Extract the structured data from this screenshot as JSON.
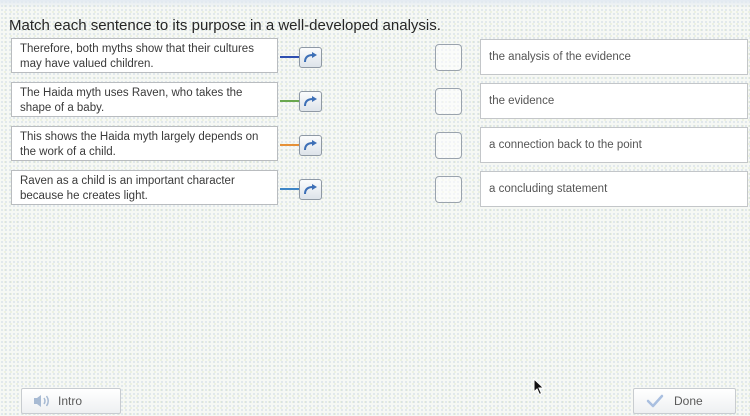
{
  "prompt": "Match each sentence to its purpose in a well-developed analysis.",
  "sentences": [
    {
      "text": "Therefore, both myths show that their cultures may have valued children.",
      "connector_color": "#2e4fb0"
    },
    {
      "text": "The Haida myth uses Raven, who takes the shape of a baby.",
      "connector_color": "#6aa84f"
    },
    {
      "text": "This shows the Haida myth largely depends on the work of a child.",
      "connector_color": "#e69138"
    },
    {
      "text": "Raven as a child is an important character because he creates light.",
      "connector_color": "#3d85c6"
    }
  ],
  "purposes": [
    {
      "text": "the analysis of the evidence"
    },
    {
      "text": "the evidence"
    },
    {
      "text": "a connection back to the point"
    },
    {
      "text": "a concluding statement"
    }
  ],
  "buttons": {
    "intro": {
      "label": "Intro",
      "icon": "speaker-icon"
    },
    "done": {
      "label": "Done",
      "icon": "checkmark-icon"
    }
  },
  "colors": {
    "accent_blue": "#3d6fb6",
    "done_check": "#a9bfe0"
  }
}
